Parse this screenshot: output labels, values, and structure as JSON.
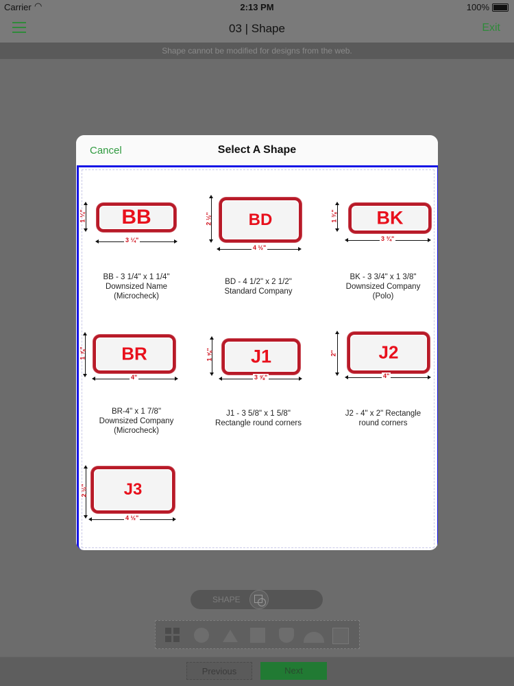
{
  "status_bar": {
    "carrier": "Carrier",
    "wifi_icon": "wifi-icon",
    "time": "2:13 PM",
    "battery": "100%"
  },
  "nav": {
    "menu_icon": "hamburger-menu-icon",
    "title": "03 | Shape",
    "exit_label": "Exit"
  },
  "notice": "Shape cannot be modified for designs from the web.",
  "modal": {
    "cancel_label": "Cancel",
    "title": "Select A Shape",
    "shapes": [
      {
        "code": "BB",
        "width_label": "3 ¼\"",
        "height_label": "1 ¼\"",
        "caption": [
          "BB - 3 1/4\" x 1 1/4\"",
          "Downsized Name",
          "(Microcheck)"
        ]
      },
      {
        "code": "BD",
        "width_label": "4 ½\"",
        "height_label": "2 ½\"",
        "caption": [
          "BD - 4 1/2\" x 2 1/2\"",
          "Standard Company"
        ]
      },
      {
        "code": "BK",
        "width_label": "3 ¾\"",
        "height_label": "1 ⅜\"",
        "caption": [
          "BK - 3 3/4\" x 1 3/8\"",
          "Downsized Company",
          "(Polo)"
        ]
      },
      {
        "code": "BR",
        "width_label": "4\"",
        "height_label": "1 ⅞\"",
        "caption": [
          "BR-4\" x 1 7/8\"",
          "Downsized Company",
          "(Microcheck)"
        ]
      },
      {
        "code": "J1",
        "width_label": "3 ⅝\"",
        "height_label": "1 ⅝\"",
        "caption": [
          "J1 - 3 5/8\" x 1 5/8\"",
          "Rectangle round corners"
        ]
      },
      {
        "code": "J2",
        "width_label": "4\"",
        "height_label": "2\"",
        "caption": [
          "J2 - 4\" x 2\" Rectangle",
          "round corners"
        ]
      },
      {
        "code": "J3",
        "width_label": "4 ½\"",
        "height_label": "2 ½\"",
        "caption": []
      }
    ]
  },
  "toolbar": {
    "shape_toggle_label": "SHAPE",
    "tools": [
      "grid-icon",
      "circle-shape-icon",
      "triangle-shape-icon",
      "square-shape-icon",
      "shield-shape-icon",
      "dome-shape-icon",
      "image-icon"
    ]
  },
  "footer": {
    "previous_label": "Previous",
    "next_label": "Next"
  },
  "colors": {
    "accent_green": "#2f9a3f",
    "selection_border": "#1414e6",
    "patch_border": "#b81a28",
    "patch_text": "#e8101c"
  }
}
